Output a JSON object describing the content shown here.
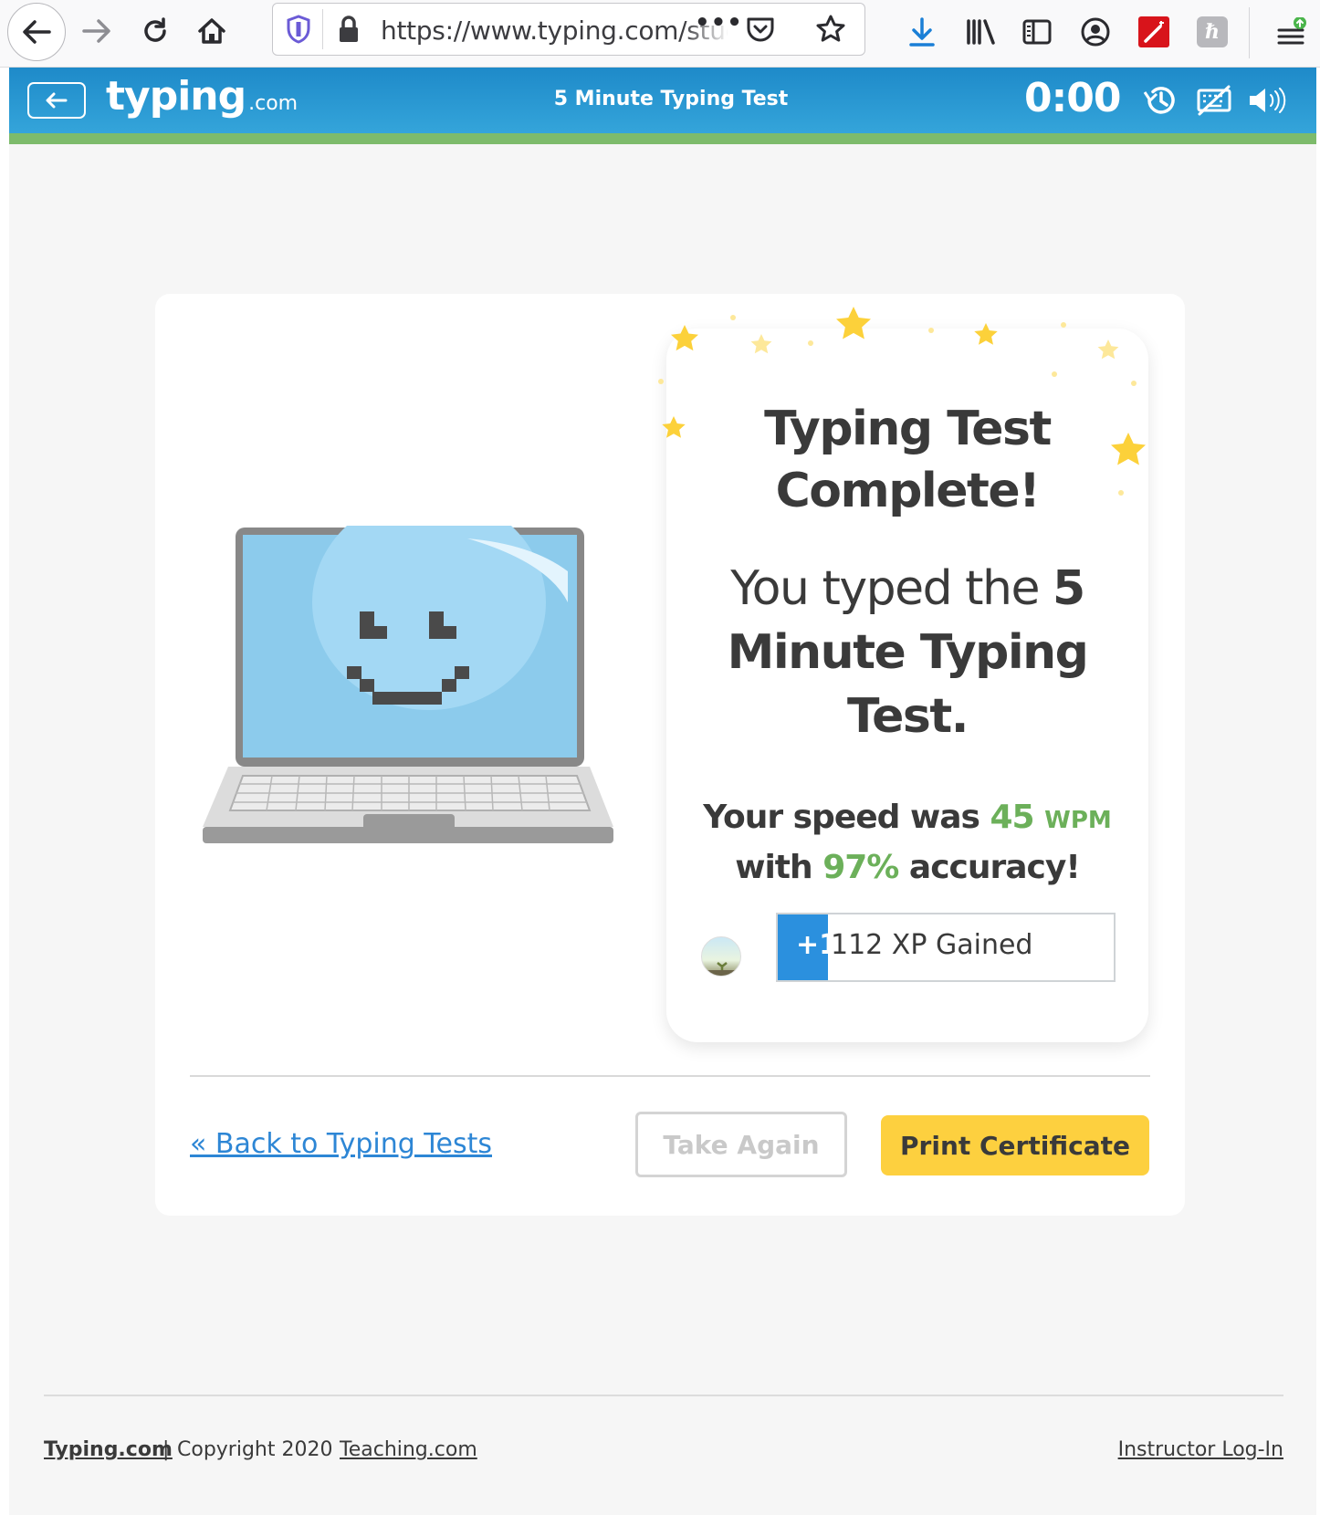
{
  "browser": {
    "url": "https://www.typing.com/student/",
    "more_icon": "•••"
  },
  "header": {
    "logo_main": "typing",
    "logo_tld": ".com",
    "title": "5 Minute Typing Test",
    "timer": "0:00"
  },
  "result": {
    "title_line1": "Typing Test",
    "title_line2": "Complete!",
    "msg_prefix": "You typed the",
    "msg_test": "5 Minute Typing Test.",
    "speed_prefix": "Your speed was",
    "wpm_value": "45",
    "wpm_unit": "WPM",
    "accuracy_prefix": "with",
    "accuracy_value": "97%",
    "accuracy_suffix": "accuracy!",
    "xp_plus": "+1",
    "xp_text": "112 XP Gained",
    "xp_progress": 0.15
  },
  "actions": {
    "back_link": "« Back to Typing Tests",
    "take_again": "Take Again",
    "print_certificate": "Print Certificate"
  },
  "footer": {
    "brand": "Typing.com",
    "separator": "|",
    "copyright": "Copyright 2020",
    "teaching": "Teaching.com",
    "instructor_login": "Instructor Log-In"
  },
  "colors": {
    "header_blue": "#1e8ac9",
    "header_stripe": "#7dbb6b",
    "accent_green": "#6cb05a",
    "xp_blue": "#2b90de",
    "print_yellow": "#fdd03f",
    "link_blue": "#2d86d5"
  }
}
